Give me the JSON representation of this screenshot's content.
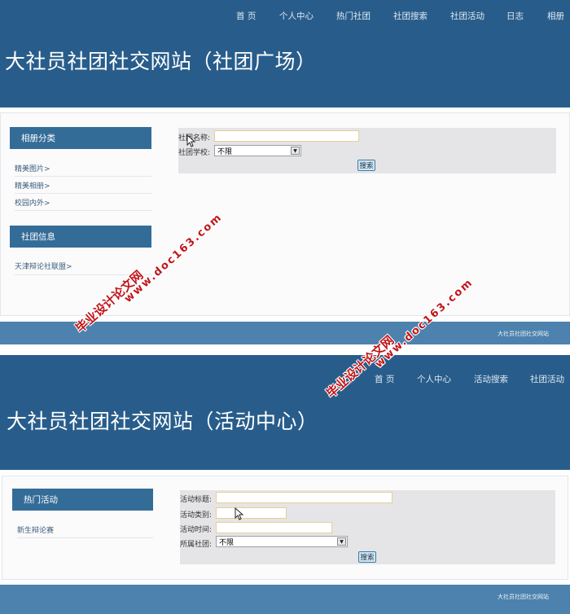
{
  "page1": {
    "nav": [
      "首 页",
      "个人中心",
      "热门社团",
      "社团搜索",
      "社团活动",
      "日志",
      "相册"
    ],
    "title": "大社员社团社交网站（社团广场）",
    "sidebar": [
      {
        "header": "相册分类",
        "links": [
          "精美图片>",
          "精美相册>",
          "校园内外>"
        ]
      },
      {
        "header": "社团信息",
        "links": [
          "天津辩论社联盟>"
        ]
      }
    ],
    "form": {
      "name_label": "社团名称:",
      "name_value": "",
      "school_label": "社团学校:",
      "school_selected": "不限",
      "search_button": "搜索"
    },
    "footer": "大社员社团社交网站"
  },
  "page2": {
    "nav": [
      "首 页",
      "个人中心",
      "活动搜索",
      "社团活动"
    ],
    "title": "大社员社团社交网站（活动中心）",
    "sidebar": [
      {
        "header": "热门活动",
        "links": [
          "新生辩论赛"
        ]
      }
    ],
    "form": {
      "title_label": "活动标题:",
      "title_value": "",
      "type_label": "活动类别:",
      "type_value": "",
      "time_label": "活动时间:",
      "time_value": "",
      "club_label": "所属社团:",
      "club_selected": "不限",
      "search_button": "搜索"
    },
    "footer": "大社员社团社交网站"
  },
  "watermarks": [
    {
      "line1": "毕业设计论文网",
      "line2": "www.doc163.com"
    },
    {
      "line1": "毕业设计论文网",
      "line2": "www.doc163.com"
    }
  ],
  "icons": {
    "select_arrow": "▼"
  },
  "colors": {
    "header": "#285d8b",
    "sidebar_header": "#346c98",
    "footer": "#4c82ad",
    "form_panel": "#e5e5e7",
    "watermark": "#c0151b"
  }
}
